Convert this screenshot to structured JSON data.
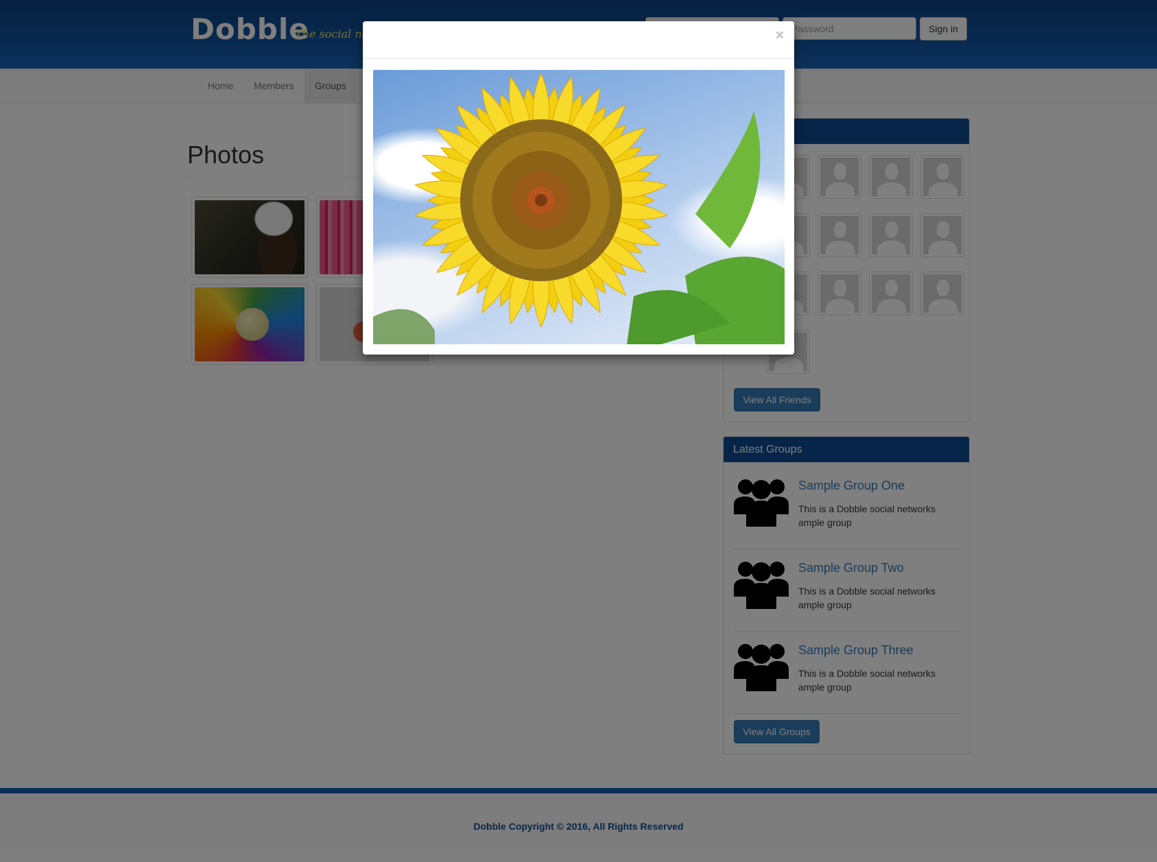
{
  "header": {
    "logo": "Dobble",
    "tagline": "The social network",
    "login_placeholder": "",
    "password_placeholder": "Password",
    "signin_label": "Sign in"
  },
  "nav": {
    "items": [
      {
        "label": "Home"
      },
      {
        "label": "Members"
      },
      {
        "label": "Groups"
      }
    ],
    "active": "Groups"
  },
  "main": {
    "title": "Photos",
    "photos": [
      {
        "subject": "eagle"
      },
      {
        "subject": "straws"
      },
      {
        "subject": "rainbow"
      },
      {
        "subject": "glass"
      }
    ]
  },
  "friends_panel": {
    "view_all_label": "View All Friends"
  },
  "groups_panel": {
    "title": "Latest Groups",
    "groups": [
      {
        "name": "Sample Group One",
        "description": "This is a Dobble social networks ample group"
      },
      {
        "name": "Sample Group Two",
        "description": "This is a Dobble social networks ample group"
      },
      {
        "name": "Sample Group Three",
        "description": "This is a Dobble social networks ample group"
      }
    ],
    "view_all_label": "View All Groups"
  },
  "footer": {
    "copyright": "Dobble Copyright © 2016, All Rights Reserved"
  },
  "modal": {
    "close_glyph": "×",
    "photo_subject": "sunflower"
  },
  "colors": {
    "brand_blue": "#0e4a91",
    "link_blue": "#337ab7",
    "tagline_yellow": "#f5e36a"
  },
  "icons": [
    "close-icon",
    "group-icon",
    "avatar-placeholder-icon"
  ]
}
